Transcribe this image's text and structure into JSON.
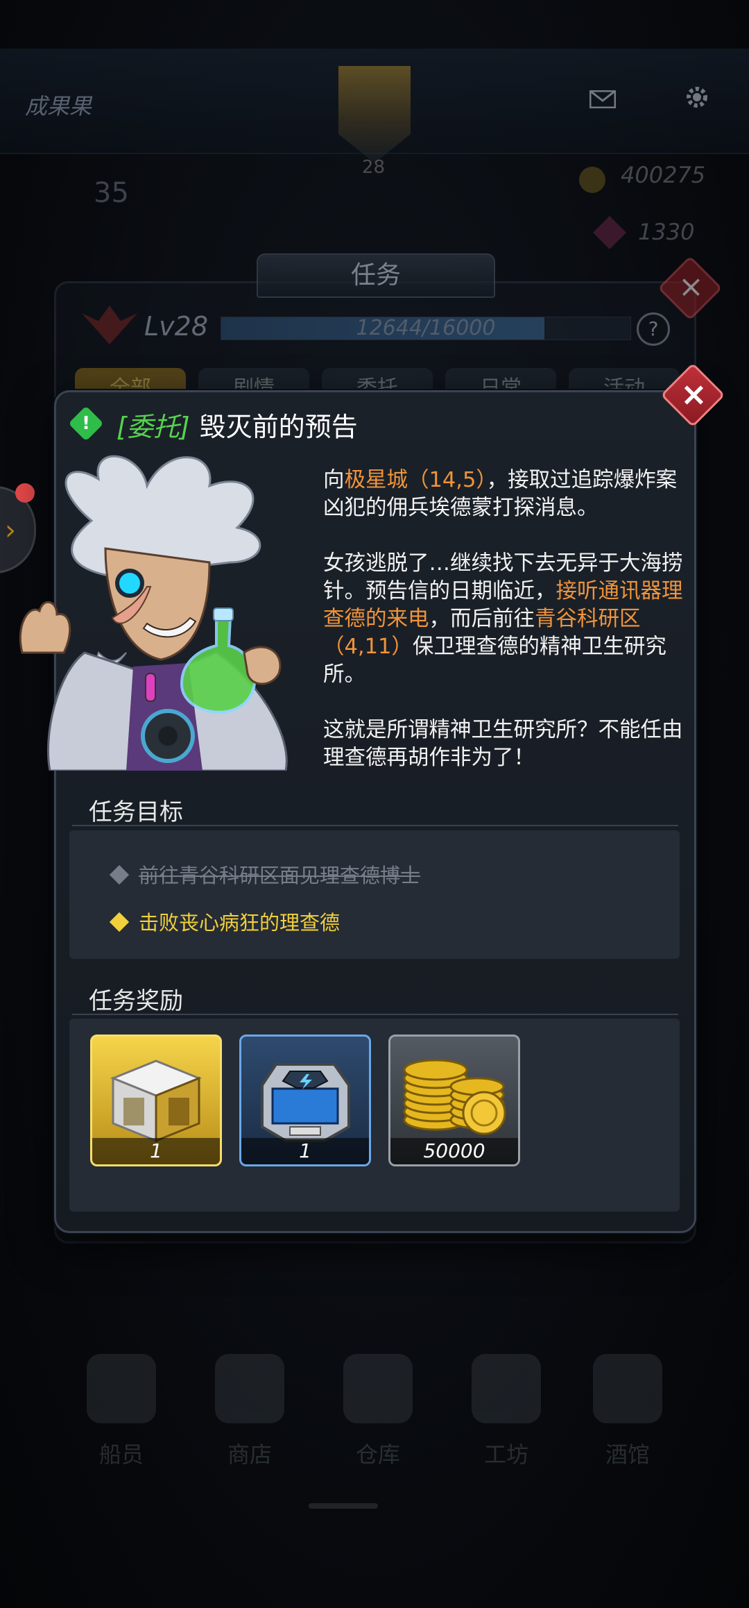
{
  "hud": {
    "player_name": "成果果",
    "avatar_level": "28",
    "stat_left": "35",
    "gold": "400275",
    "gems": "1330"
  },
  "quest_window": {
    "title": "任务",
    "level_label": "Lv28",
    "xp_text": "12644/16000",
    "xp_fraction": 0.79,
    "tabs": [
      "全部",
      "剧情",
      "委托",
      "日常",
      "活动"
    ],
    "active_tab": 0
  },
  "modal": {
    "tag": "[委托]",
    "name": "毁灭前的预告",
    "desc": {
      "p1_a": "向",
      "p1_b": "极星城（14,5）",
      "p1_c": "，接取过追踪爆炸案凶犯的佣兵埃德蒙打探消息。",
      "p2_a": "女孩逃脱了…继续找下去无异于大海捞针。预告信的日期临近，",
      "p2_b": "接听通讯器理查德的来电",
      "p2_c": "，而后前往",
      "p2_d": "青谷科研区（4,11）",
      "p2_e": "保卫理查德的精神卫生研究所。",
      "p3": "这就是所谓精神卫生研究所？不能任由理查德再胡作非为了！"
    },
    "objectives_title": "任务目标",
    "objectives": [
      {
        "text": "前往青谷科研区面见理查德博士",
        "done": true
      },
      {
        "text": "击败丧心病狂的理查德",
        "done": false
      }
    ],
    "rewards_title": "任务奖励",
    "rewards": [
      {
        "icon": "gold-supply-crate-icon",
        "count": "1"
      },
      {
        "icon": "blue-energy-core-icon",
        "count": "1"
      },
      {
        "icon": "gold-coins-icon",
        "count": "50000"
      }
    ]
  },
  "nav": [
    "船员",
    "商店",
    "仓库",
    "工坊",
    "酒馆"
  ],
  "colors": {
    "tag_green": "#56d24f",
    "highlight_orange": "#f0943a",
    "objective_yellow": "#f2d03a",
    "close_red": "#c0303a"
  }
}
